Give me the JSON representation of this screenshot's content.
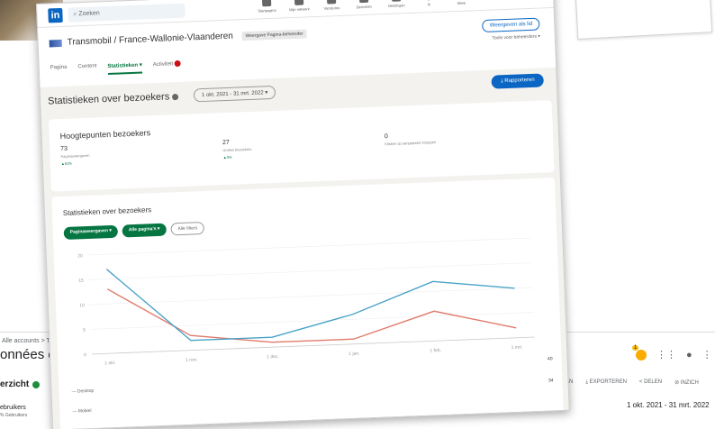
{
  "linkedin": {
    "search_placeholder": "Zoeken",
    "nav": [
      {
        "label": "Startpagina",
        "icon": "home-icon",
        "badge": false
      },
      {
        "label": "Mijn netwerk",
        "icon": "network-icon",
        "badge": true
      },
      {
        "label": "Vacatures",
        "icon": "jobs-icon",
        "badge": false
      },
      {
        "label": "Berichten",
        "icon": "messaging-icon",
        "badge": false
      },
      {
        "label": "Meldingen",
        "icon": "bell-icon",
        "badge": false
      },
      {
        "label": "Ik",
        "icon": "profile-icon",
        "badge": false
      },
      {
        "label": "Werk",
        "icon": "grid-icon",
        "badge": false
      }
    ],
    "company_name": "Transmobil / France-Wallonie-Vlaanderen",
    "company_tag": "Weergave Pagina-beheerder",
    "view_as_member": "Weergeven als lid",
    "admin_tools": "Tools voor beheerders",
    "tabs": [
      {
        "label": "Pagina",
        "active": false
      },
      {
        "label": "Content",
        "active": false
      },
      {
        "label": "Statistieken",
        "active": true
      },
      {
        "label": "Activiteit",
        "active": false
      }
    ],
    "stats_title": "Statistieken over bezoekers",
    "date_range": "1 okt. 2021 - 31 mrt. 2022",
    "report_button": "Rapporteren",
    "highlights": {
      "title": "Hoogtepunten bezoekers",
      "metrics": [
        {
          "value": "73",
          "label": "Paginaweergaven",
          "change": "▲61%"
        },
        {
          "value": "27",
          "label": "Unieke bezoekers",
          "change": "▲0%"
        },
        {
          "value": "0",
          "label": "Klikken op aangepaste knoppen",
          "change": ""
        }
      ]
    },
    "visitor_chart": {
      "title": "Statistieken over bezoekers",
      "filters": [
        "Paginaweergaven",
        "Alle pagina's",
        "Alle filters"
      ],
      "legend": [
        {
          "name": "Desktop",
          "total": "40",
          "color": "#e07b6c"
        },
        {
          "name": "Mobiel",
          "total": "34",
          "color": "#4aa3c7"
        }
      ]
    }
  },
  "chart_data": {
    "type": "line",
    "x": [
      "1 okt.",
      "1 nov.",
      "1 dec.",
      "1 jan.",
      "1 feb.",
      "1 mrt."
    ],
    "series": [
      {
        "name": "Desktop",
        "values": [
          13,
          3,
          1,
          1,
          6,
          2
        ]
      },
      {
        "name": "Mobiel",
        "values": [
          17,
          2,
          2,
          6,
          12,
          10
        ]
      }
    ],
    "ylim": [
      0,
      20
    ],
    "yticks": [
      "20",
      "15",
      "10",
      "5",
      "0"
    ],
    "grid": true
  },
  "analytics": {
    "breadcrumb": "Alle accounts > Transmobil",
    "title": "onnées du s",
    "overview": "erzicht",
    "users_label": "ebruikers",
    "users_sub": "% Gebruikers",
    "notification_count": "1",
    "actions": [
      "AAN",
      "EXPORTEREN",
      "DELEN",
      "INZICH"
    ],
    "date_range": "1 okt. 2021 - 31 mrt. 2022"
  }
}
